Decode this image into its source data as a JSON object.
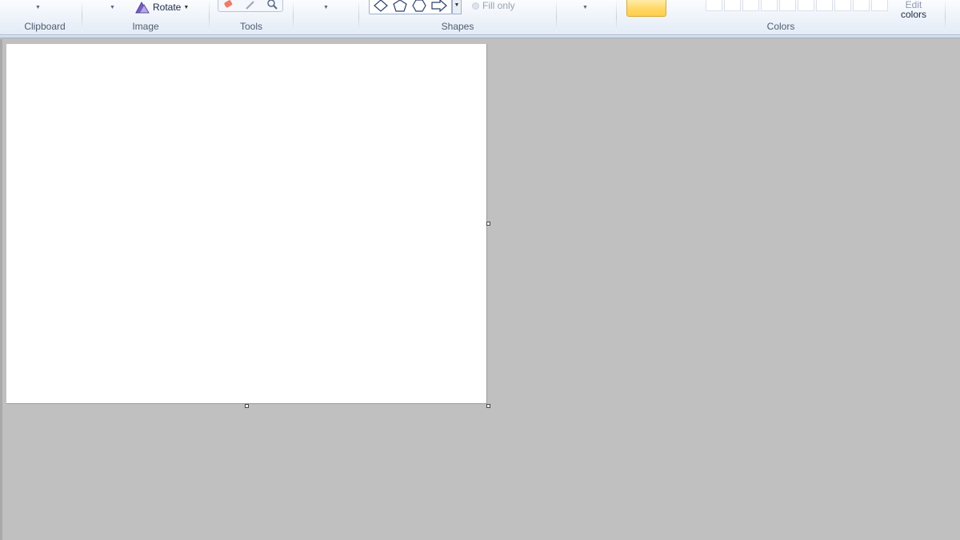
{
  "ribbon": {
    "groups": {
      "clipboard": "Clipboard",
      "image": "Image",
      "tools": "Tools",
      "shapes": "Shapes",
      "colors": "Colors"
    },
    "image": {
      "rotate_label": "Rotate",
      "rotate_icon": "rotate-icon"
    },
    "tools": {
      "icons": [
        "eraser-icon",
        "color-picker-icon",
        "magnifier-icon"
      ]
    },
    "shapes": {
      "items": [
        "diamond-shape",
        "pentagon-shape",
        "hexagon-shape",
        "right-arrow-shape"
      ],
      "fill_label": "Fill only"
    },
    "colors": {
      "edit_label_line1": "Edit",
      "edit_label_line2": "colors",
      "active_color": "#ffd96b",
      "custom_swatch_count": 10
    }
  },
  "workspace": {
    "background": "#c0c0c0",
    "canvas_color": "#ffffff"
  }
}
